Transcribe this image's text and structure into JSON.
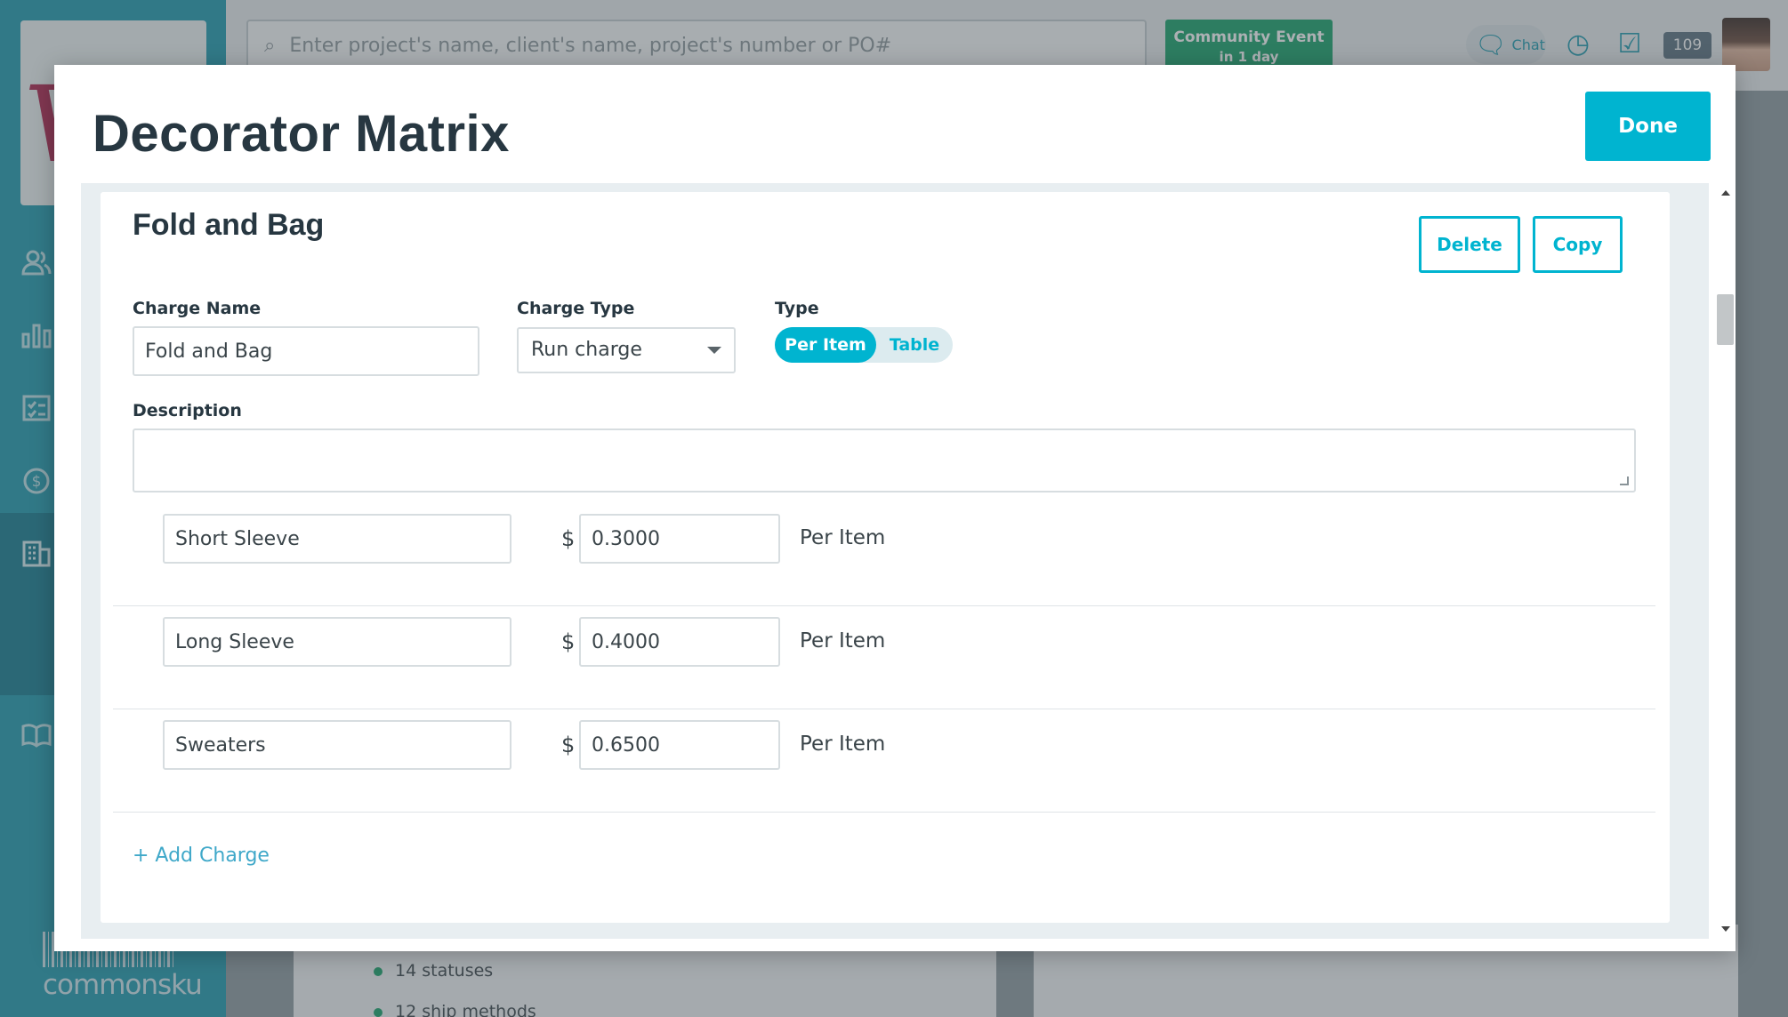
{
  "app": {
    "search_placeholder": "Enter project's name, client's name, project's number or PO#",
    "community_event": {
      "title": "Community Event",
      "subtitle": "in 1 day"
    },
    "chat_label": "Chat",
    "notification_count": "109",
    "brand": "commonsku",
    "background_list": [
      "14 statuses",
      "12 ship methods"
    ],
    "colors": {
      "sidebar": "#1f9bb0",
      "accent": "#00b4d0",
      "community": "#18a36b"
    }
  },
  "modal": {
    "title": "Decorator Matrix",
    "done_label": "Done"
  },
  "card": {
    "title": "Fold and Bag",
    "delete_label": "Delete",
    "copy_label": "Copy",
    "charge_name_label": "Charge Name",
    "charge_name_value": "Fold and Bag",
    "charge_type_label": "Charge Type",
    "charge_type_value": "Run charge",
    "type_label": "Type",
    "type_options": [
      "Per Item",
      "Table"
    ],
    "type_selected": "Per Item",
    "description_label": "Description",
    "description_value": "",
    "charges": [
      {
        "name": "Short Sleeve",
        "currency": "$",
        "amount": "0.3000",
        "unit": "Per Item"
      },
      {
        "name": "Long Sleeve",
        "currency": "$",
        "amount": "0.4000",
        "unit": "Per Item"
      },
      {
        "name": "Sweaters",
        "currency": "$",
        "amount": "0.6500",
        "unit": "Per Item"
      }
    ],
    "add_charge_label": "+ Add Charge"
  }
}
